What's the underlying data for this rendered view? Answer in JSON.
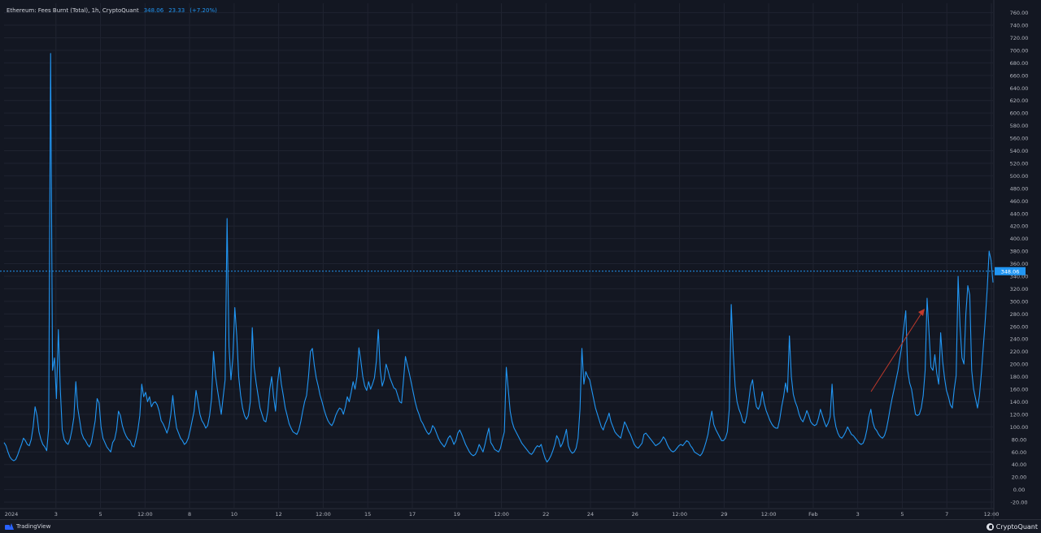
{
  "header": {
    "title": "Ethereum: Fees Burnt (Total), 1h, CryptoQuant",
    "last_value": "348.06",
    "change": "23.33",
    "change_pct": "(+7.20%)"
  },
  "price_tag": "348.06",
  "branding": {
    "tradingview": "TradingView",
    "cryptoquant": "CryptoQuant"
  },
  "colors": {
    "background": "#131722",
    "grid": "#1f2330",
    "line": "#2196f3",
    "price_line": "#2196f3",
    "arrow": "#c0392b",
    "axis_text": "#b2b5be"
  },
  "chart_data": {
    "type": "line",
    "ylim": [
      -29,
      775
    ],
    "y_ticks": [
      -20,
      0,
      20,
      40,
      60,
      80,
      100,
      120,
      140,
      160,
      180,
      200,
      220,
      240,
      260,
      280,
      300,
      320,
      340,
      360,
      380,
      400,
      420,
      440,
      460,
      480,
      500,
      520,
      540,
      560,
      580,
      600,
      620,
      640,
      660,
      680,
      700,
      720,
      740,
      760
    ],
    "x_ticks": [
      "2024",
      "3",
      "5",
      "12:00",
      "8",
      "10",
      "12",
      "12:00",
      "15",
      "17",
      "19",
      "12:00",
      "22",
      "24",
      "26",
      "12:00",
      "29",
      "12:00",
      "Feb",
      "3",
      "5",
      "7",
      "12:00"
    ],
    "current_value": 348.06,
    "series": [
      {
        "values": [
          75,
          70,
          60,
          52,
          48,
          46,
          48,
          55,
          64,
          72,
          82,
          78,
          72,
          70,
          80,
          100,
          132,
          118,
          92,
          80,
          72,
          68,
          62,
          98,
          695,
          190,
          210,
          145,
          255,
          160,
          95,
          80,
          75,
          72,
          80,
          95,
          115,
          172,
          130,
          110,
          90,
          82,
          78,
          72,
          68,
          75,
          92,
          110,
          145,
          138,
          100,
          82,
          75,
          68,
          64,
          60,
          75,
          80,
          95,
          125,
          118,
          102,
          92,
          85,
          80,
          78,
          70,
          68,
          80,
          95,
          118,
          168,
          148,
          155,
          140,
          148,
          132,
          138,
          140,
          135,
          125,
          110,
          105,
          98,
          90,
          100,
          120,
          150,
          120,
          98,
          90,
          82,
          78,
          72,
          75,
          82,
          95,
          110,
          125,
          158,
          140,
          120,
          110,
          105,
          98,
          102,
          118,
          145,
          220,
          182,
          160,
          140,
          120,
          148,
          175,
          432,
          228,
          175,
          210,
          290,
          245,
          180,
          150,
          130,
          118,
          112,
          118,
          140,
          258,
          195,
          170,
          150,
          130,
          120,
          110,
          108,
          125,
          160,
          180,
          148,
          125,
          170,
          195,
          168,
          150,
          130,
          118,
          105,
          98,
          92,
          90,
          88,
          95,
          108,
          125,
          140,
          150,
          180,
          220,
          225,
          198,
          178,
          165,
          150,
          140,
          128,
          118,
          110,
          105,
          102,
          108,
          118,
          125,
          130,
          128,
          120,
          132,
          148,
          140,
          155,
          172,
          160,
          180,
          226,
          205,
          180,
          165,
          158,
          172,
          160,
          168,
          178,
          205,
          255,
          190,
          165,
          175,
          200,
          190,
          178,
          170,
          162,
          160,
          150,
          140,
          138,
          175,
          212,
          198,
          185,
          170,
          155,
          140,
          128,
          120,
          110,
          105,
          98,
          92,
          88,
          92,
          102,
          98,
          90,
          82,
          76,
          72,
          68,
          74,
          82,
          86,
          80,
          72,
          78,
          90,
          95,
          88,
          80,
          72,
          66,
          60,
          56,
          54,
          56,
          62,
          72,
          66,
          60,
          72,
          86,
          98,
          75,
          70,
          64,
          62,
          60,
          66,
          80,
          92,
          195,
          160,
          125,
          108,
          98,
          92,
          86,
          80,
          74,
          70,
          66,
          62,
          58,
          56,
          60,
          66,
          70,
          68,
          72,
          60,
          50,
          44,
          48,
          54,
          62,
          72,
          86,
          80,
          68,
          74,
          84,
          96,
          70,
          62,
          58,
          60,
          66,
          82,
          128,
          225,
          168,
          188,
          180,
          175,
          160,
          145,
          130,
          120,
          110,
          100,
          95,
          105,
          112,
          122,
          108,
          100,
          92,
          88,
          85,
          82,
          95,
          108,
          102,
          94,
          88,
          80,
          72,
          68,
          66,
          70,
          74,
          88,
          90,
          86,
          82,
          78,
          74,
          70,
          72,
          74,
          78,
          84,
          80,
          72,
          66,
          62,
          60,
          62,
          66,
          70,
          72,
          70,
          74,
          78,
          76,
          70,
          66,
          60,
          58,
          56,
          54,
          58,
          66,
          76,
          88,
          108,
          125,
          104,
          96,
          90,
          84,
          78,
          78,
          82,
          92,
          128,
          295,
          220,
          165,
          140,
          128,
          120,
          108,
          106,
          118,
          140,
          165,
          175,
          150,
          132,
          128,
          136,
          156,
          138,
          126,
          118,
          110,
          104,
          100,
          98,
          98,
          112,
          132,
          148,
          170,
          155,
          245,
          180,
          152,
          140,
          132,
          120,
          112,
          108,
          116,
          126,
          118,
          108,
          104,
          102,
          104,
          114,
          128,
          118,
          108,
          100,
          106,
          116,
          168,
          118,
          100,
          90,
          84,
          82,
          86,
          92,
          100,
          94,
          88,
          86,
          82,
          78,
          74,
          72,
          74,
          82,
          96,
          116,
          128,
          108,
          98,
          94,
          88,
          84,
          82,
          86,
          96,
          112,
          130,
          146,
          160,
          175,
          190,
          210,
          230,
          258,
          285,
          190,
          170,
          160,
          140,
          120,
          118,
          120,
          130,
          150,
          190,
          305,
          250,
          195,
          190,
          215,
          185,
          168,
          250,
          205,
          178,
          158,
          148,
          135,
          130,
          160,
          182,
          340,
          260,
          210,
          200,
          280,
          325,
          310,
          190,
          160,
          145,
          130,
          150,
          185,
          228,
          270,
          320,
          380,
          365,
          330
        ]
      }
    ]
  }
}
